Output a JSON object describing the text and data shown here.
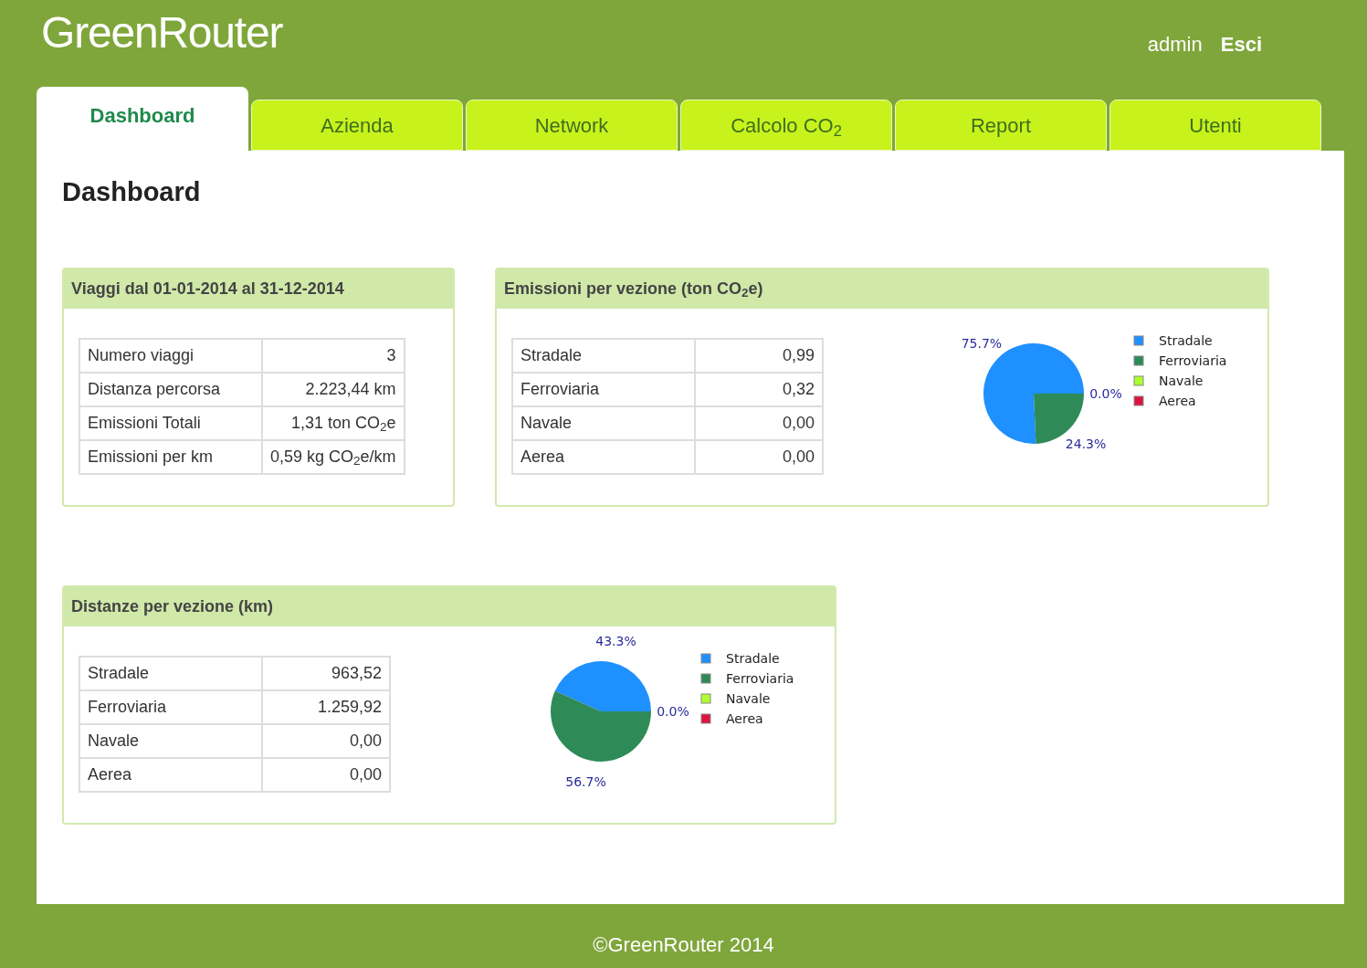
{
  "header": {
    "logo": "GreenRouter",
    "user": "admin",
    "logout": "Esci"
  },
  "tabs": [
    {
      "label": "Dashboard",
      "selected": true
    },
    {
      "label": "Azienda",
      "selected": false
    },
    {
      "label": "Network",
      "selected": false
    },
    {
      "label": "Calcolo CO$_{2}$",
      "selected": false
    },
    {
      "label": "Report",
      "selected": false
    },
    {
      "label": "Utenti",
      "selected": false
    }
  ],
  "page_title": "Dashboard",
  "panels": [
    {
      "title": "Viaggi dal 01-01-2014 al 31-12-2014",
      "rows": [
        {
          "label": "Numero viaggi",
          "value": "3"
        },
        {
          "label": "Distanza percorsa",
          "value": "2.223,44 km"
        },
        {
          "label": "Emissioni Totali",
          "value": "1,31 ton CO$_{2}$e"
        },
        {
          "label": "Emissioni per km",
          "value": "0,59 kg CO$_{2}$e/km"
        }
      ]
    },
    {
      "title": "Emissioni per vezione (ton CO$_{2}$e)",
      "rows": [
        {
          "label": "Stradale",
          "value": "0,99"
        },
        {
          "label": "Ferroviaria",
          "value": "0,32"
        },
        {
          "label": "Navale",
          "value": "0,00"
        },
        {
          "label": "Aerea",
          "value": "0,00"
        }
      ],
      "chart_data": {
        "type": "pie",
        "categories": [
          "Stradale",
          "Ferroviaria",
          "Navale",
          "Aerea"
        ],
        "values": [
          75.7,
          24.3,
          0,
          0
        ],
        "legend": "right",
        "colors": [
          "#1e90ff",
          "#2e8b57",
          "#adff2f",
          "#dc143c"
        ],
        "value_labels": [
          "75.7%",
          "24.3%",
          "0.0%",
          null
        ]
      }
    },
    {
      "title": "Distanze per vezione (km)",
      "rows": [
        {
          "label": "Stradale",
          "value": "963,52"
        },
        {
          "label": "Ferroviaria",
          "value": "1.259,92"
        },
        {
          "label": "Navale",
          "value": "0,00"
        },
        {
          "label": "Aerea",
          "value": "0,00"
        }
      ],
      "chart_data": {
        "type": "pie",
        "categories": [
          "Stradale",
          "Ferroviaria",
          "Navale",
          "Aerea"
        ],
        "values": [
          43.3,
          56.7,
          0,
          0
        ],
        "legend": "right",
        "colors": [
          "#1e90ff",
          "#2e8b57",
          "#adff2f",
          "#dc143c"
        ],
        "value_labels": [
          "43.3%",
          "56.7%",
          "0.0%",
          null
        ]
      }
    }
  ],
  "footer": "©GreenRouter 2014"
}
